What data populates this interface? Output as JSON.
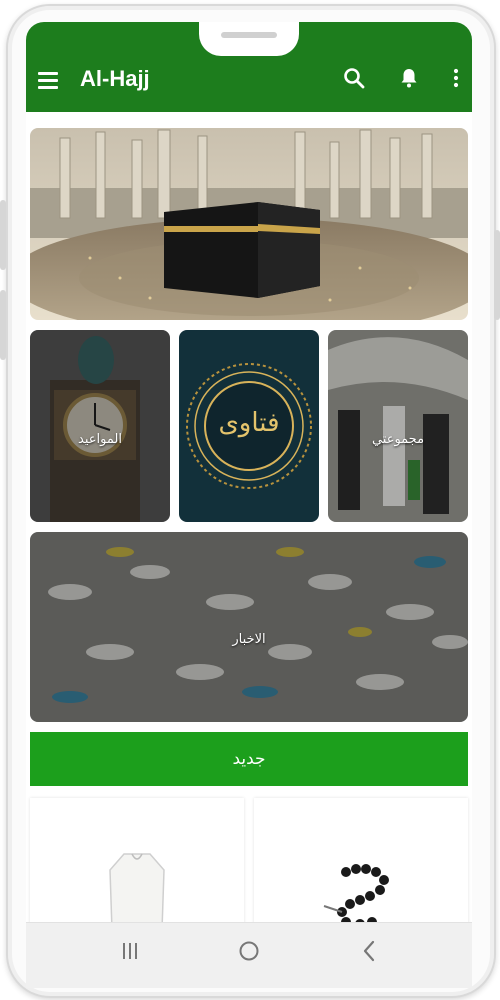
{
  "app": {
    "title": "Al-Hajj"
  },
  "colors": {
    "primary": "#1d7d1d",
    "accent_button": "#1c9f1c"
  },
  "appbar": {
    "icons": [
      "menu-icon",
      "search-icon",
      "bell-icon",
      "more-vert-icon"
    ]
  },
  "tiles": {
    "appointments_label": "المواعيد",
    "fatwas_text": "فتاوى",
    "my_group_label": "مجموعتي",
    "news_label": "الاخبار"
  },
  "new_button": {
    "label": "جديد"
  },
  "system_nav": {
    "icons": [
      "recent-apps-icon",
      "home-icon",
      "back-icon"
    ]
  }
}
